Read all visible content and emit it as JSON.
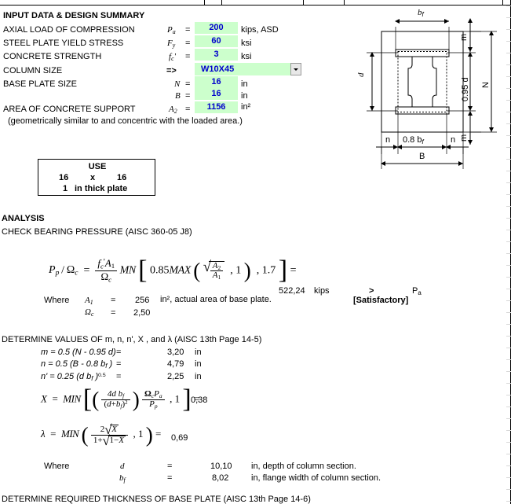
{
  "sections": {
    "input_title": "INPUT DATA & DESIGN SUMMARY",
    "analysis_title": "ANALYSIS",
    "check_bearing_title": "CHECK BEARING PRESSURE (AISC 360-05 J8)",
    "determine_values_title": "DETERMINE VALUES OF m, n, n', X , and λ (AISC 13th Page 14-5)",
    "determine_thickness_title": "DETERMINE REQUIRED THICKNESS OF BASE PLATE (AISC 13th Page 14-6)"
  },
  "input_rows": [
    {
      "label": "AXIAL LOAD OF COMPRESSION",
      "symbol": "P",
      "sub": "a",
      "eq": "=",
      "value": "200",
      "unit": "kips, ASD"
    },
    {
      "label": "STEEL PLATE YIELD STRESS",
      "symbol": "F",
      "sub": "y",
      "eq": "=",
      "value": "60",
      "unit": "ksi"
    },
    {
      "label": "CONCRETE STRENGTH",
      "symbol": "f",
      "sub": "c",
      "prime": "'",
      "eq": "=",
      "value": "3",
      "unit": "ksi"
    },
    {
      "label": "COLUMN SIZE",
      "symbol": "=>",
      "sub": "",
      "eq": "",
      "value": "W10X45",
      "unit": ""
    },
    {
      "label": "BASE PLATE SIZE",
      "symbol": "N",
      "sub": "",
      "eq": "=",
      "value": "16",
      "unit": "in"
    },
    {
      "label": "",
      "symbol": "B",
      "sub": "",
      "eq": "=",
      "value": "16",
      "unit": "in"
    },
    {
      "label": "AREA OF CONCRETE SUPPORT",
      "symbol": "A",
      "sub": "2",
      "eq": "=",
      "value": "1156",
      "unit": "in²"
    }
  ],
  "input_note": "(geometrically similar to and concentric with the loaded area.)",
  "use_box": {
    "title": "USE",
    "width": "16",
    "times": "x",
    "length": "16",
    "thickness": "1",
    "thickness_note": "in thick plate"
  },
  "bearing": {
    "formula_lhs_var": "P",
    "formula_lhs_sub": "p",
    "formula_lhs_denom": "Ω",
    "formula_lhs_denom_sub": "c",
    "frac_num_fc": "f",
    "frac_num_fc_sub": "c",
    "frac_num_prime": "'",
    "frac_num_A1": "A",
    "frac_num_A1_sub": "1",
    "frac_den": "Ω",
    "frac_den_sub": "c",
    "mn": "MN",
    "const_085": "0.85",
    "max_fn": "MAX",
    "sqrt_num": "A",
    "sqrt_num_sub": "2",
    "sqrt_den": "A",
    "sqrt_den_sub": "1",
    "one": "1",
    "const_17": "1.7",
    "equals": "=",
    "result": "522,24",
    "result_unit": "kips",
    "compare_op": ">",
    "compare_to": "P",
    "compare_to_sub": "a",
    "verdict": "[Satisfactory]",
    "where": "Where",
    "A1_label": "A",
    "A1_sub": "1",
    "A1_eq": "=",
    "A1_value": "256",
    "A1_note": "in², actual area of base plate.",
    "omega_label": "Ω",
    "omega_sub": "c",
    "omega_eq": "=",
    "omega_value": "2,50"
  },
  "values": [
    {
      "expr_html": "m",
      "formula": "= 0.5 (N - 0.95 d)",
      "eq": "=",
      "value": "3,20",
      "unit": "in"
    },
    {
      "expr_html": "n",
      "formula": "= 0.5 (B - 0.8 b f )",
      "eq": "=",
      "value": "4,79",
      "unit": "in"
    },
    {
      "expr_html": "n'",
      "formula": "= 0.25 (d b f ) 0.5",
      "eq": "=",
      "value": "2,25",
      "unit": "in"
    }
  ],
  "x_formula": {
    "lhs": "X",
    "eq1": "=",
    "min_fn": "MIN",
    "num": "4d b",
    "num_sub": "f",
    "den_open": "(",
    "den_d": "d",
    "den_plus": "+",
    "den_bf": "b",
    "den_bf_sub": "f",
    "den_close": ")",
    "den_pow": "2",
    "second_num_omega": "Ω",
    "second_num_omega_sub": "c",
    "second_num_P": "P",
    "second_num_P_sub": "a",
    "second_den_P": "P",
    "second_den_P_sub": "p",
    "one": "1",
    "eq2": "=",
    "result": "0,38"
  },
  "lambda_formula": {
    "lhs": "λ",
    "eq1": "=",
    "min_fn": "MIN",
    "num_two": "2",
    "num_sqrt": "X",
    "den_one": "1",
    "den_plus": "+",
    "den_sqrt_one": "1",
    "den_sqrt_minus": "−",
    "den_sqrt_X": "X",
    "one": "1",
    "eq2": "=",
    "result": "0,69"
  },
  "column_props": {
    "where": "Where",
    "rows": [
      {
        "symbol": "d",
        "sub": "",
        "eq": "=",
        "value": "10,10",
        "note": "in, depth of column section."
      },
      {
        "symbol": "b",
        "sub": "f",
        "eq": "=",
        "value": "8,02",
        "note": "in, flange width of column section."
      }
    ]
  },
  "diagram": {
    "label_bf": "b",
    "label_bf_sub": "f",
    "label_d": "d",
    "label_m_top": "m",
    "label_m_bottom": "m",
    "label_095d": "0.95 d",
    "label_N": "N",
    "label_n_left": "n",
    "label_n_right": "n",
    "label_08bf": "0.8 b",
    "label_08bf_sub": "f",
    "label_B": "B"
  },
  "colors": {
    "input_fill": "#ccffcc",
    "input_text": "#0000cc",
    "text": "#000000"
  }
}
